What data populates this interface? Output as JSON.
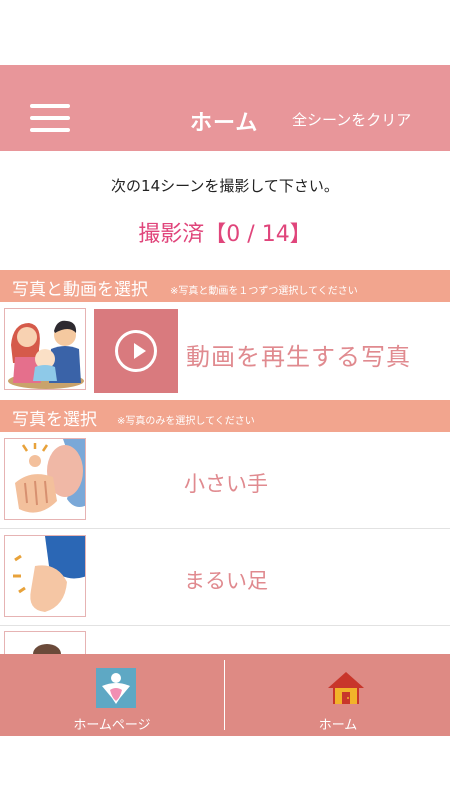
{
  "header": {
    "title": "ホーム",
    "clear_label": "全シーンをクリア",
    "menu_icon": "hamburger-menu-icon",
    "color": "#e8969a"
  },
  "instruction": "次の14シーンを撮影して下さい。",
  "progress": "撮影済【0 / 14】",
  "section_video": {
    "title": "写真と動画を選択",
    "note": "※写真と動画を１つずつ選択してください",
    "video_label": "動画を再生する写真",
    "play_icon": "play-icon"
  },
  "section_photo": {
    "title": "写真を選択",
    "note": "※写真のみを選択してください",
    "items": [
      {
        "label": "小さい手"
      },
      {
        "label": "まるい足"
      }
    ]
  },
  "bottom_nav": {
    "homepage_label": "ホームページ",
    "home_label": "ホーム",
    "color": "#de8a84"
  }
}
